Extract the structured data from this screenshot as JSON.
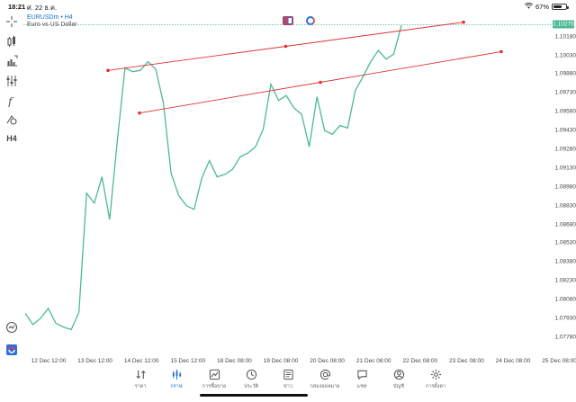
{
  "status_bar": {
    "time": "18:21",
    "date": "ศ. 22 ธ.ค.",
    "battery": "67%",
    "battery_level": 0.67
  },
  "chart": {
    "symbol": "EURUSDm • H4",
    "description": "Euro vs US Dollar",
    "current_price": "1.10275",
    "trade_buttons": [
      "buy-sell",
      "one-click"
    ],
    "price_ticks": [
      "1.10180",
      "1.10030",
      "1.09880",
      "1.09730",
      "1.09580",
      "1.09430",
      "1.09280",
      "1.09130",
      "1.08980",
      "1.08830",
      "1.08680",
      "1.08530",
      "1.08380",
      "1.08230",
      "1.08080",
      "1.07930",
      "1.07780"
    ],
    "time_ticks": [
      "12 Dec 12:00",
      "13 Dec 12:00",
      "14 Dec 12:00",
      "15 Dec 12:00",
      "18 Dec 08:00",
      "19 Dec 08:00",
      "20 Dec 08:00",
      "21 Dec 08:00",
      "22 Dec 08:00",
      "23 Dec 08:00",
      "24 Dec 08:00",
      "25 Dec 08:00"
    ],
    "colors": {
      "line": "#4cb896",
      "trend": "#e03030",
      "accent": "#1a6fd1"
    }
  },
  "chart_data": {
    "type": "line",
    "series": [
      {
        "values": [
          1.0797,
          1.0788,
          1.0793,
          1.0801,
          1.0789,
          1.0786,
          1.0784,
          1.0798,
          1.0893,
          1.0885,
          1.0906,
          1.0872,
          1.0935,
          1.0993,
          1.099,
          1.0991,
          1.0998,
          1.0992,
          1.0965,
          1.0909,
          1.0891,
          1.0883,
          1.088,
          1.0905,
          1.0919,
          1.0906,
          1.0908,
          1.0912,
          1.0922,
          1.0925,
          1.093,
          1.0944,
          1.098,
          1.0967,
          1.0971,
          1.0961,
          1.0956,
          1.093,
          1.097,
          1.0943,
          1.094,
          1.0947,
          1.0945,
          1.0975,
          1.0986,
          1.0998,
          1.1007,
          1.1,
          1.1004,
          1.1027
        ]
      }
    ],
    "trend_lines": [
      {
        "from": 1.0991,
        "to": 1.10295
      },
      {
        "from": 1.0957,
        "to": 1.1006
      }
    ],
    "ylim": [
      1.077,
      1.103
    ]
  },
  "toolbar": {
    "tools": [
      "crosshair-icon",
      "indicators-icon",
      "timeframe-icon",
      "chart-type-icon",
      "function-icon",
      "objects-icon"
    ],
    "timeframe": "H4"
  },
  "tabs": [
    {
      "label": "ราคา",
      "icon": "quotes-icon"
    },
    {
      "label": "กราฟ",
      "icon": "chart-icon",
      "active": true
    },
    {
      "label": "การซื้อขาย",
      "icon": "trade-icon"
    },
    {
      "label": "ประวัติ",
      "icon": "history-icon"
    },
    {
      "label": "ข่าว",
      "icon": "news-icon"
    },
    {
      "label": "กล่องจดหมาย",
      "icon": "mailbox-icon"
    },
    {
      "label": "แชท",
      "icon": "chat-icon"
    },
    {
      "label": "บัญชี",
      "icon": "account-icon"
    },
    {
      "label": "การตั้งค่า",
      "icon": "settings-icon"
    }
  ]
}
